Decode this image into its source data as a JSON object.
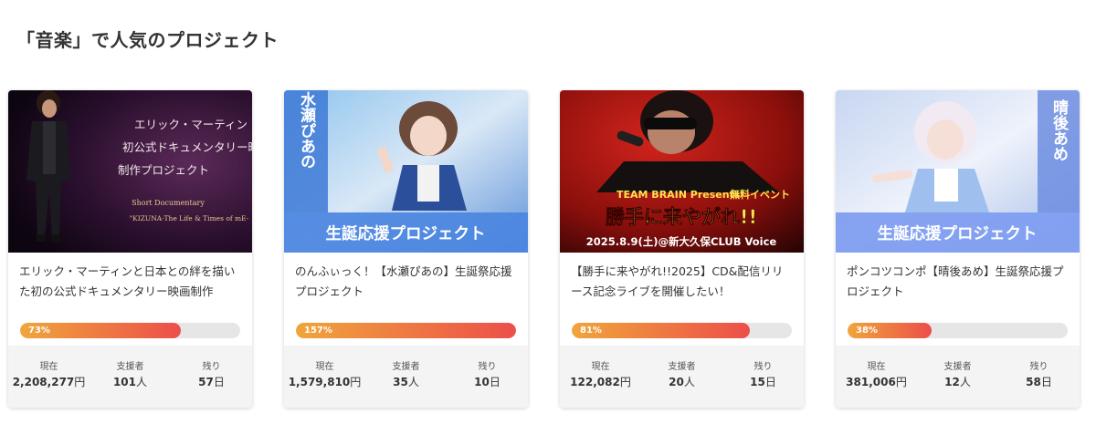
{
  "section": {
    "title": "「音楽」で人気のプロジェクト"
  },
  "labels": {
    "current": "現在",
    "supporters": "支援者",
    "remaining": "残り",
    "yen": "円",
    "people": "人",
    "days": "日"
  },
  "cards": [
    {
      "image": {
        "lines": [
          "エリック・マーティン",
          "初公式ドキュメンタリー映",
          "制作プロジェクト"
        ],
        "sub1": "Short Documentary",
        "sub2": "\"KIZUNA-The Life & Times of mE-"
      },
      "title": "エリック・マーティンと日本との絆を描いた初の公式ドキュメンタリー映画制作",
      "percent": 73,
      "percent_label": "73%",
      "current_amount": "2,208,277",
      "supporters": "101",
      "days_left": "57"
    },
    {
      "image": {
        "name_vertical": "水瀬ぴあの",
        "banner": "生誕応援プロジェクト"
      },
      "title": "のんふぃっく！【水瀬ぴあの】生誕祭応援プロジェクト",
      "percent": 100,
      "percent_label": "157%",
      "current_amount": "1,579,810",
      "supporters": "35",
      "days_left": "10"
    },
    {
      "image": {
        "caption1": "TEAM BRAIN Presents",
        "caption1b": "無料イベント",
        "caption2": "勝手に来やがれ!!",
        "caption3": "2025.8.9(土)@新大久保CLUB Voice"
      },
      "title": "【勝手に来やがれ!!2025】CD&配信リリース記念ライブを開催したい！",
      "percent": 81,
      "percent_label": "81%",
      "current_amount": "122,082",
      "supporters": "20",
      "days_left": "15"
    },
    {
      "image": {
        "name_vertical": "晴後あめ",
        "banner": "生誕応援プロジェクト"
      },
      "title": "ポンコツコンポ【晴後あめ】生誕祭応援プロジェクト",
      "percent": 38,
      "percent_label": "38%",
      "current_amount": "381,006",
      "supporters": "12",
      "days_left": "58"
    }
  ],
  "colors": {
    "bar_start": "#f0a53b",
    "bar_end": "#ec4f4a",
    "bar_track": "#e6e6e6",
    "stats_bg": "#f4f4f4"
  }
}
